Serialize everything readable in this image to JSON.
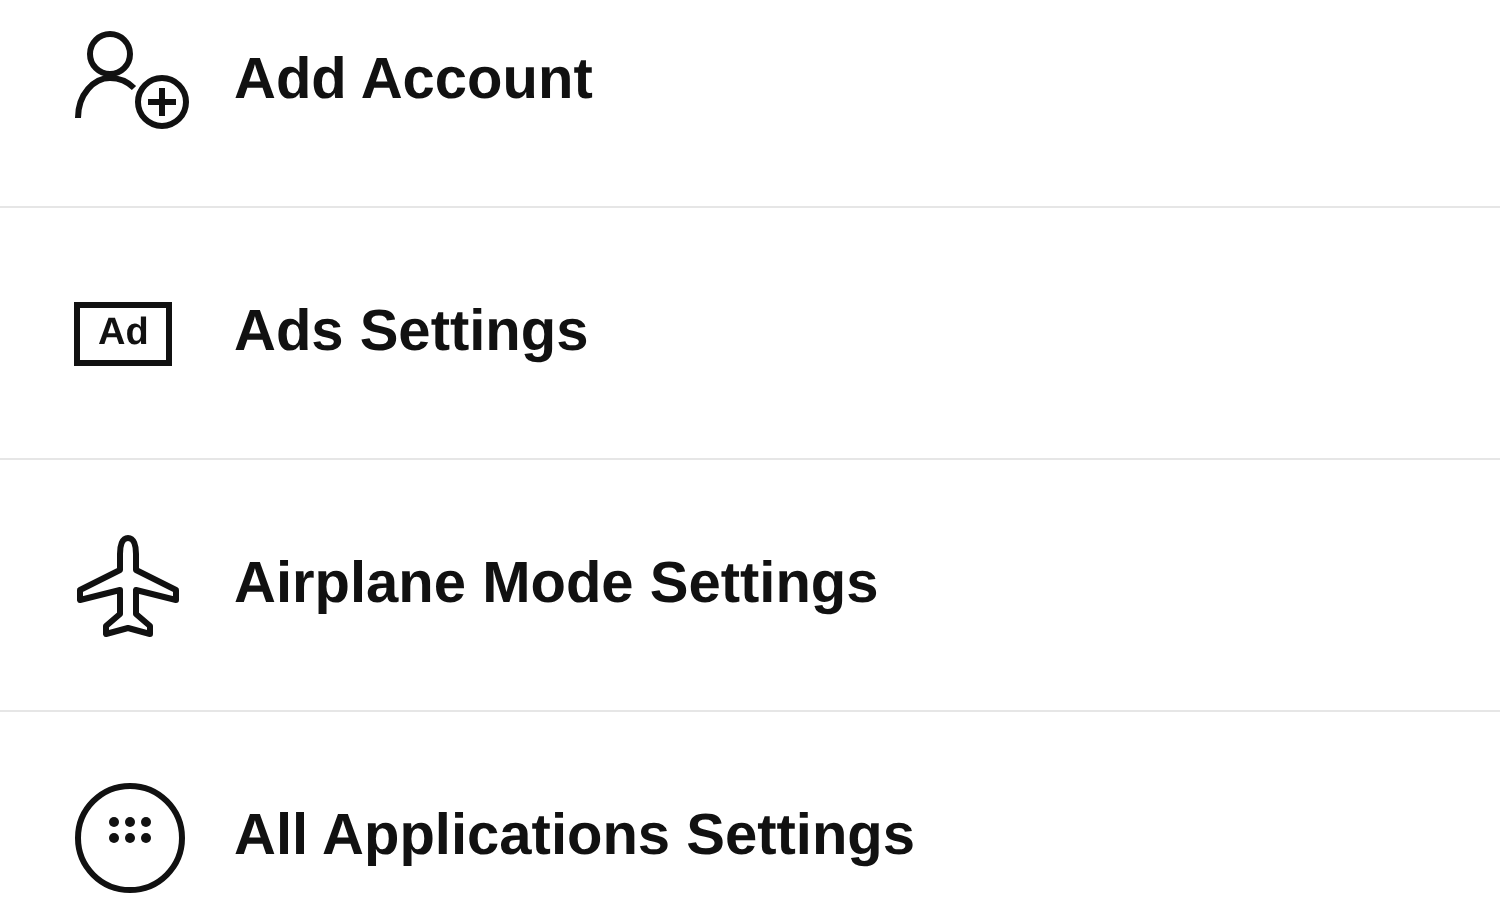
{
  "settings_list": [
    {
      "kind": "account",
      "label": "Add Account"
    },
    {
      "kind": "ads",
      "label": "Ads Settings",
      "icon_text": "Ad"
    },
    {
      "kind": "airplane",
      "label": "Airplane Mode Settings"
    },
    {
      "kind": "apps",
      "label": "All Applications Settings"
    }
  ]
}
